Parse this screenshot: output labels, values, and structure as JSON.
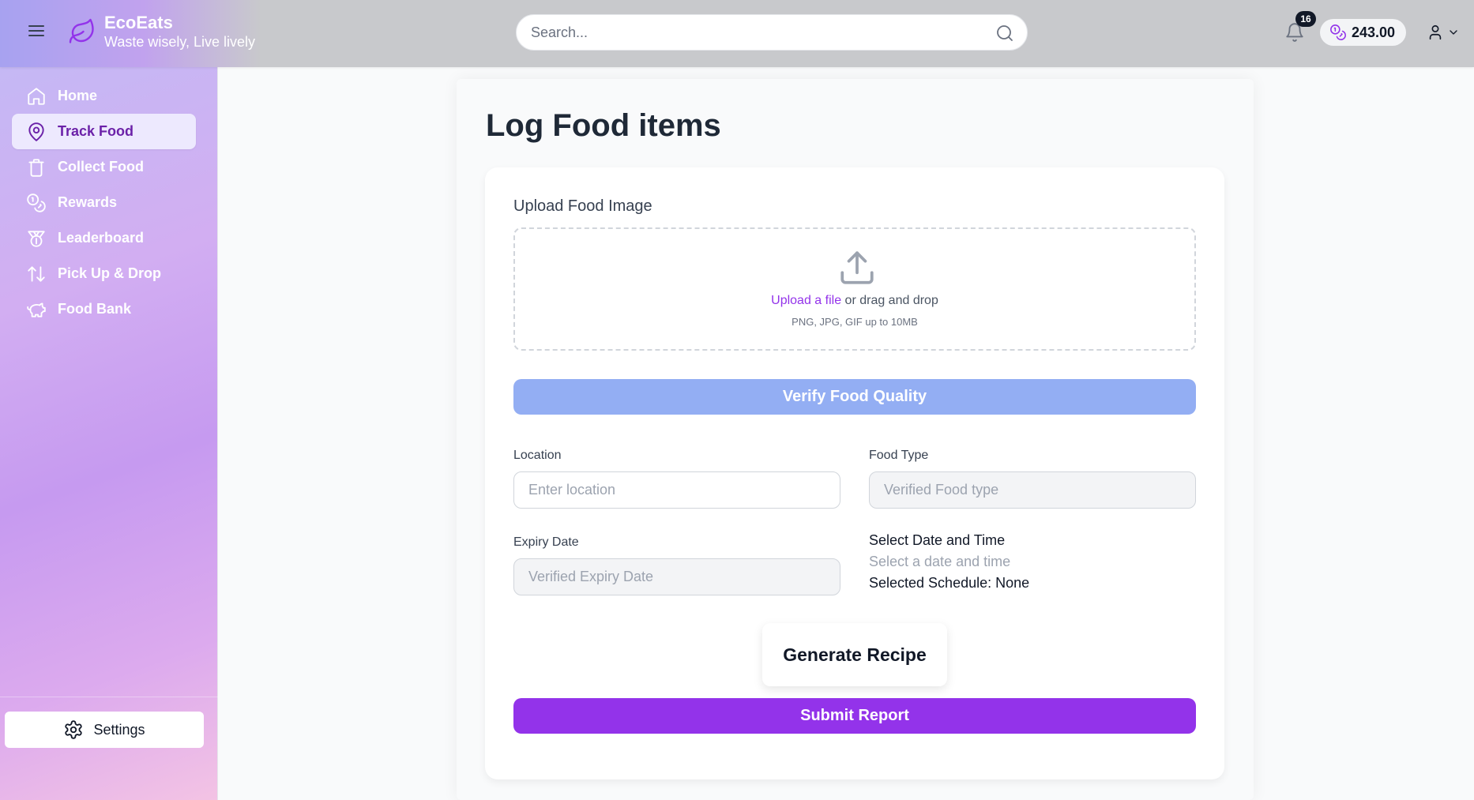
{
  "header": {
    "brand_title": "EcoEats",
    "brand_subtitle": "Waste wisely, Live lively",
    "search_placeholder": "Search...",
    "notification_count": "16",
    "balance": "243.00"
  },
  "sidebar": {
    "items": [
      {
        "label": "Home",
        "icon": "home-icon"
      },
      {
        "label": "Track Food",
        "icon": "map-pin-icon",
        "active": true
      },
      {
        "label": "Collect Food",
        "icon": "trash-icon"
      },
      {
        "label": "Rewards",
        "icon": "coins-icon"
      },
      {
        "label": "Leaderboard",
        "icon": "medal-icon"
      },
      {
        "label": "Pick Up & Drop",
        "icon": "arrow-up-down-icon"
      },
      {
        "label": "Food Bank",
        "icon": "piggy-bank-icon"
      }
    ],
    "settings_label": "Settings"
  },
  "main": {
    "title": "Log Food items",
    "upload": {
      "label": "Upload Food Image",
      "link_text": "Upload a file",
      "drag_text": " or drag and drop",
      "hint": "PNG, JPG, GIF up to 10MB"
    },
    "verify_button": "Verify Food Quality",
    "location": {
      "label": "Location",
      "placeholder": "Enter location"
    },
    "food_type": {
      "label": "Food Type",
      "placeholder": "Verified Food type"
    },
    "expiry": {
      "label": "Expiry Date",
      "placeholder": "Verified Expiry Date"
    },
    "schedule": {
      "title": "Select Date and Time",
      "placeholder": "Select a date and time",
      "selected": "Selected Schedule: None"
    },
    "generate_button": "Generate Recipe",
    "submit_button": "Submit Report"
  },
  "colors": {
    "accent": "#9333ea",
    "verify_button": "#93aef3",
    "header_bg": "#c8c9cc",
    "active_nav_bg": "#ede9fe"
  }
}
